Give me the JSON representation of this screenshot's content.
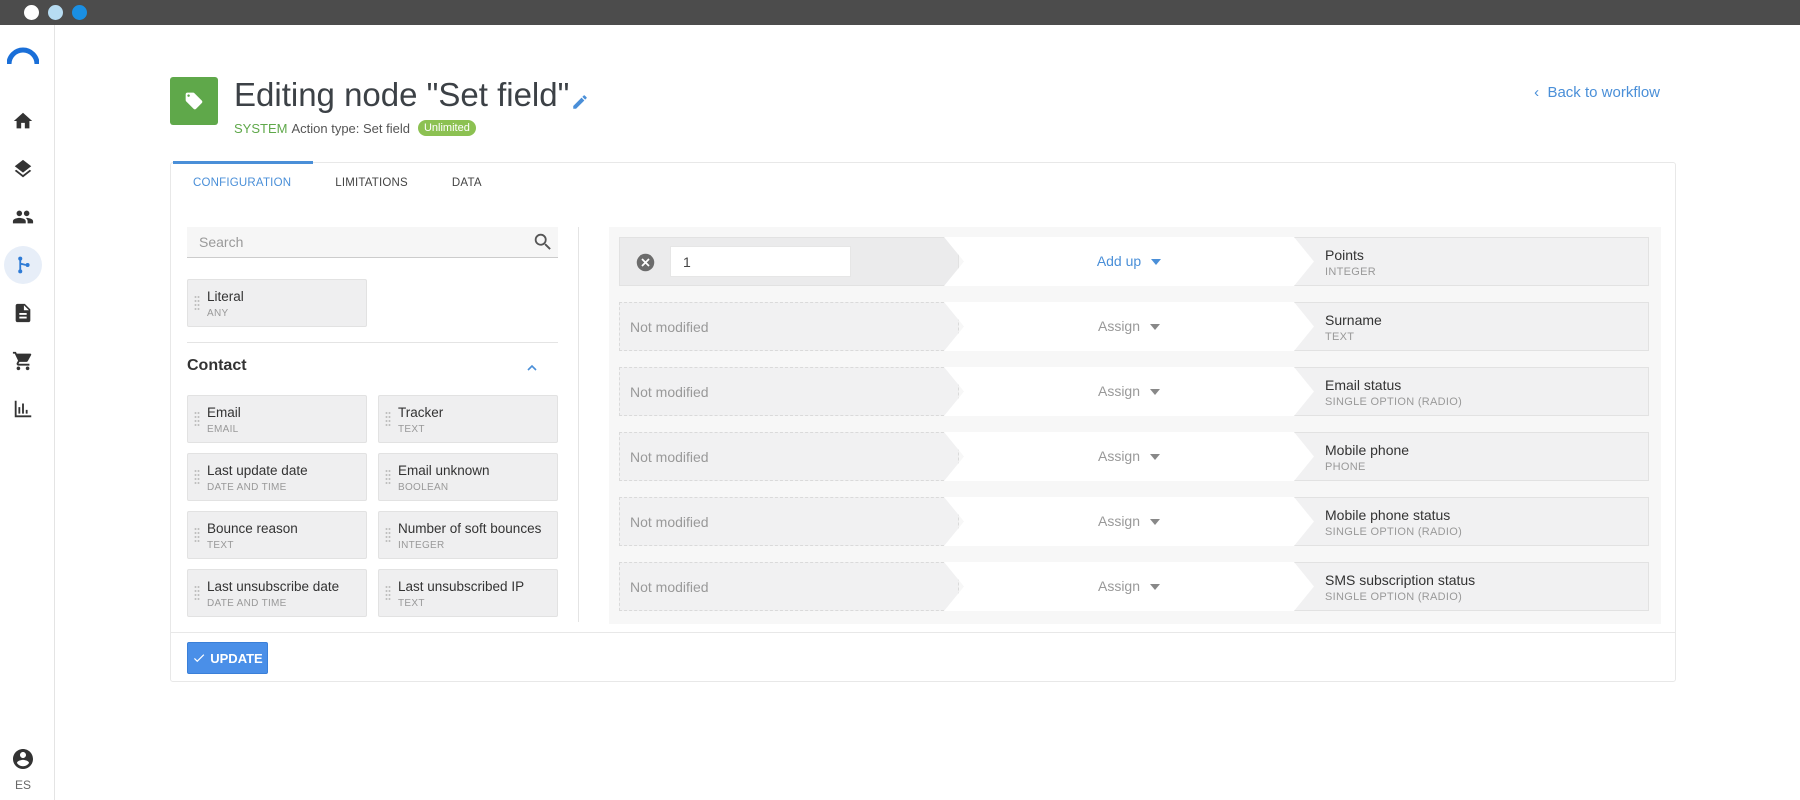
{
  "window": {
    "controls": [
      "close",
      "minimize",
      "maximize"
    ]
  },
  "sidebar": {
    "logo": "logo-icon",
    "items": [
      {
        "icon": "home-icon",
        "active": false
      },
      {
        "icon": "layers-icon",
        "active": false
      },
      {
        "icon": "people-icon",
        "active": false
      },
      {
        "icon": "workflow-icon",
        "active": true
      },
      {
        "icon": "document-icon",
        "active": false
      },
      {
        "icon": "cart-icon",
        "active": false
      },
      {
        "icon": "bar-chart-icon",
        "active": false
      }
    ],
    "language": "ES"
  },
  "header": {
    "title": "Editing node \"Set field\"",
    "system_label": "SYSTEM",
    "action_type": "Action type: Set field",
    "badge": "Unlimited",
    "back_link": "Back to workflow"
  },
  "tabs": [
    {
      "label": "CONFIGURATION",
      "active": true
    },
    {
      "label": "LIMITATIONS",
      "active": false
    },
    {
      "label": "DATA",
      "active": false
    }
  ],
  "search": {
    "placeholder": "Search",
    "value": ""
  },
  "literal": {
    "name": "Literal",
    "type": "ANY"
  },
  "contact_section": {
    "title": "Contact",
    "fields": [
      {
        "name": "Email",
        "type": "EMAIL"
      },
      {
        "name": "Tracker",
        "type": "TEXT"
      },
      {
        "name": "Last update date",
        "type": "DATE AND TIME"
      },
      {
        "name": "Email unknown",
        "type": "BOOLEAN"
      },
      {
        "name": "Bounce reason",
        "type": "TEXT"
      },
      {
        "name": "Number of soft bounces",
        "type": "INTEGER"
      },
      {
        "name": "Last unsubscribe date",
        "type": "DATE AND TIME"
      },
      {
        "name": "Last unsubscribed IP",
        "type": "TEXT"
      }
    ]
  },
  "mappings": [
    {
      "source": "1",
      "operation": "Add up",
      "target": "Points",
      "target_type": "INTEGER"
    },
    {
      "source": "Not modified",
      "operation": "Assign",
      "target": "Surname",
      "target_type": "TEXT"
    },
    {
      "source": "Not modified",
      "operation": "Assign",
      "target": "Email status",
      "target_type": "SINGLE OPTION (RADIO)"
    },
    {
      "source": "Not modified",
      "operation": "Assign",
      "target": "Mobile phone",
      "target_type": "PHONE"
    },
    {
      "source": "Not modified",
      "operation": "Assign",
      "target": "Mobile phone status",
      "target_type": "SINGLE OPTION (RADIO)"
    },
    {
      "source": "Not modified",
      "operation": "Assign",
      "target": "SMS subscription status",
      "target_type": "SINGLE OPTION (RADIO)"
    }
  ],
  "footer": {
    "update_label": "UPDATE"
  },
  "colors": {
    "accent": "#4a8fd8",
    "node_green": "#5fa84a",
    "badge_green": "#8cc152"
  }
}
